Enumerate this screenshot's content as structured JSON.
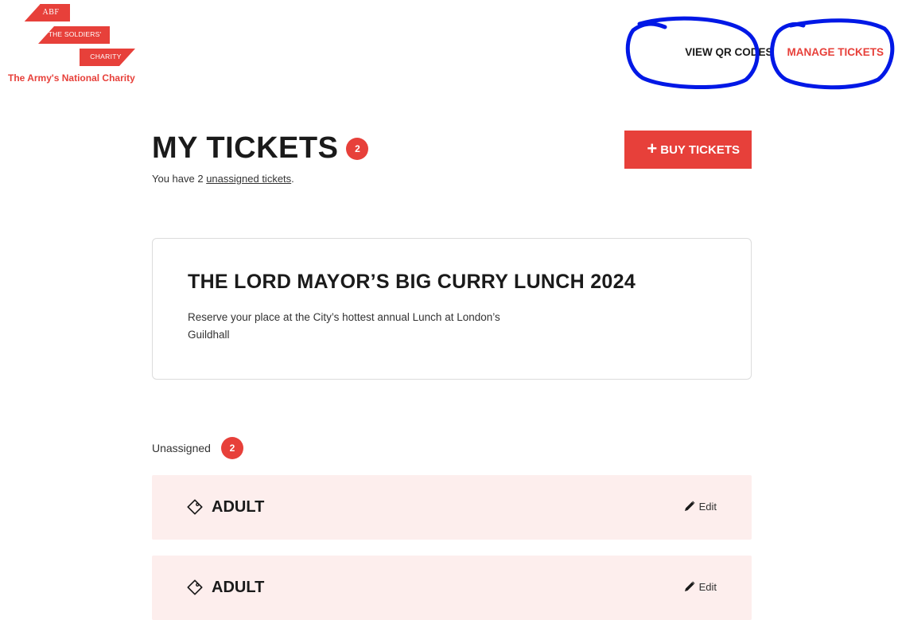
{
  "brand": {
    "logo_abf": "ABF",
    "logo_line1": "THE SOLDIERS'",
    "logo_line2": "CHARITY",
    "tagline": "The Army's National Charity",
    "accent_color": "#e7403a",
    "annotation_color": "#0018e6"
  },
  "nav": {
    "view_qr": "VIEW QR CODES",
    "manage": "MANAGE TICKETS"
  },
  "page": {
    "title": "MY TICKETS",
    "count": "2",
    "subtitle_pre": "You have 2 ",
    "subtitle_link": "unassigned tickets",
    "subtitle_post": ".",
    "buy_label": "BUY TICKETS"
  },
  "event": {
    "title": "THE LORD MAYOR’S BIG CURRY LUNCH 2024",
    "description": "Reserve your place at the City’s hottest annual Lunch at London’s Guildhall"
  },
  "unassigned": {
    "label": "Unassigned",
    "count": "2"
  },
  "tickets": [
    {
      "name": "ADULT",
      "edit_label": "Edit",
      "icon": "ticket-icon"
    },
    {
      "name": "ADULT",
      "edit_label": "Edit",
      "icon": "ticket-icon"
    }
  ]
}
